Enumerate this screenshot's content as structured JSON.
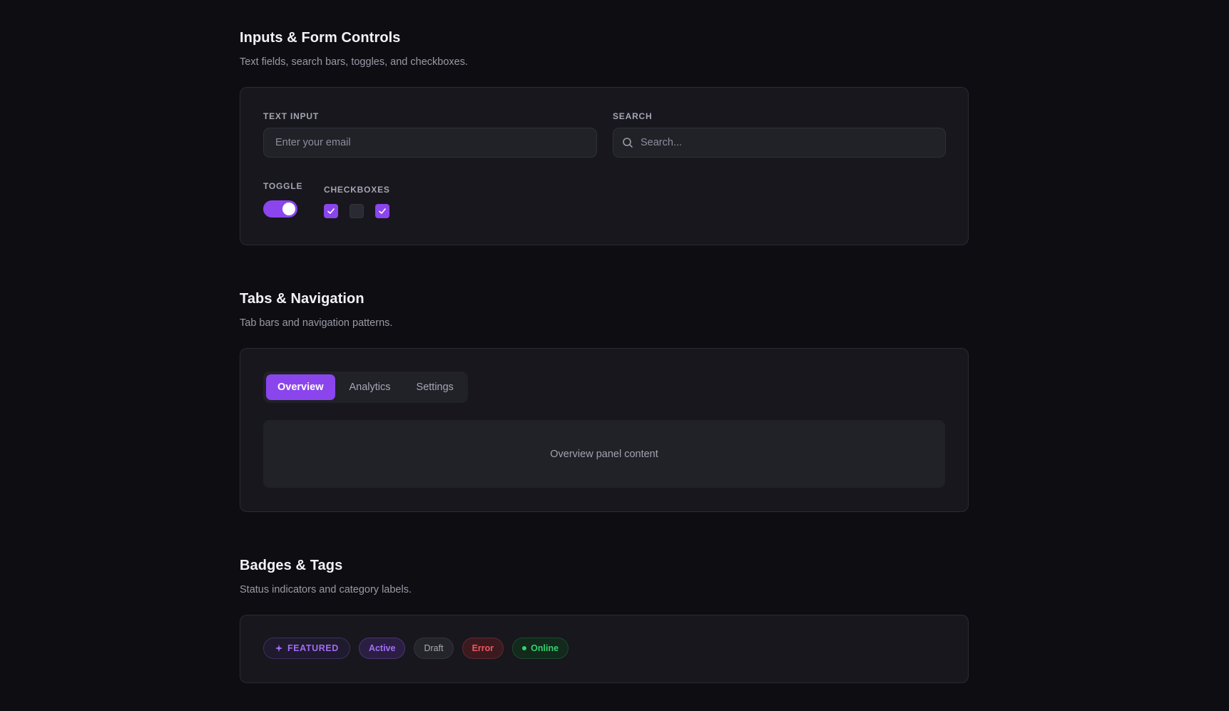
{
  "sections": {
    "inputs": {
      "title": "Inputs & Form Controls",
      "subtitle": "Text fields, search bars, toggles, and checkboxes.",
      "text_input": {
        "label": "TEXT INPUT",
        "placeholder": "Enter your email"
      },
      "search": {
        "label": "SEARCH",
        "placeholder": "Search..."
      },
      "toggle": {
        "label": "TOGGLE",
        "on": true
      },
      "checkboxes": {
        "label": "CHECKBOXES",
        "states": [
          true,
          false,
          true
        ]
      }
    },
    "tabs": {
      "title": "Tabs & Navigation",
      "subtitle": "Tab bars and navigation patterns.",
      "items": [
        {
          "label": "Overview",
          "active": true
        },
        {
          "label": "Analytics",
          "active": false
        },
        {
          "label": "Settings",
          "active": false
        }
      ],
      "panel_text": "Overview panel content"
    },
    "badges": {
      "title": "Badges & Tags",
      "subtitle": "Status indicators and category labels.",
      "items": [
        {
          "label": "FEATURED",
          "kind": "featured",
          "icon": "sparkle-icon"
        },
        {
          "label": "Active",
          "kind": "active"
        },
        {
          "label": "Draft",
          "kind": "draft"
        },
        {
          "label": "Error",
          "kind": "error"
        },
        {
          "label": "Online",
          "kind": "online",
          "icon": "status-dot-icon"
        }
      ]
    }
  },
  "colors": {
    "accent": "#8b45ec",
    "background": "#0d0d12",
    "card": "#17171d",
    "error": "#f0565f",
    "success": "#35d06e"
  }
}
